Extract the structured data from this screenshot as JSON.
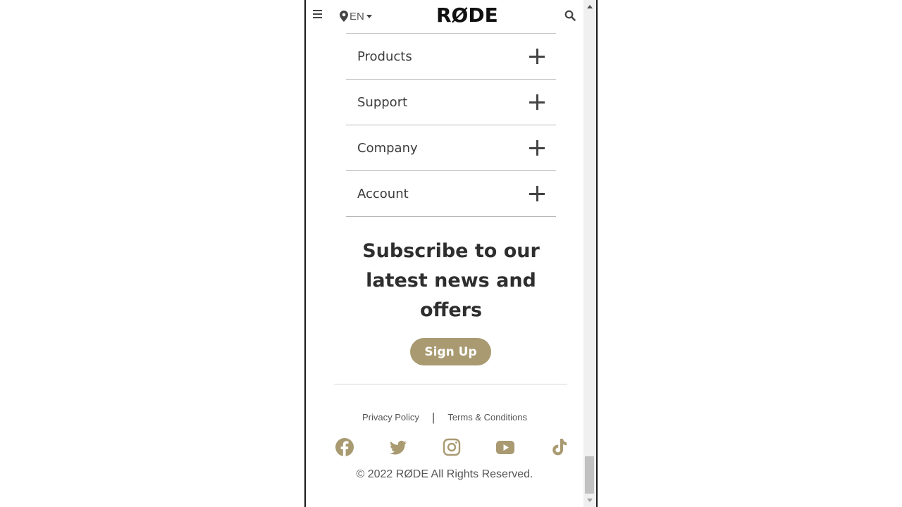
{
  "header": {
    "locale_label": "EN",
    "logo_text": "RØDE"
  },
  "accordion": [
    {
      "label": "Products"
    },
    {
      "label": "Support"
    },
    {
      "label": "Company"
    },
    {
      "label": "Account"
    }
  ],
  "subscribe": {
    "heading": "Subscribe to our latest news and offers",
    "button_label": "Sign Up"
  },
  "legal": {
    "privacy_label": "Privacy Policy",
    "separator": "|",
    "terms_label": "Terms & Conditions"
  },
  "social_icons": [
    "facebook-icon",
    "twitter-icon",
    "instagram-icon",
    "youtube-icon",
    "tiktok-icon"
  ],
  "copyright": "© 2022 RØDE All Rights Reserved.",
  "colors": {
    "accent": "#a99a72",
    "text_dark": "#2e2e2e",
    "text_muted": "#555555"
  }
}
